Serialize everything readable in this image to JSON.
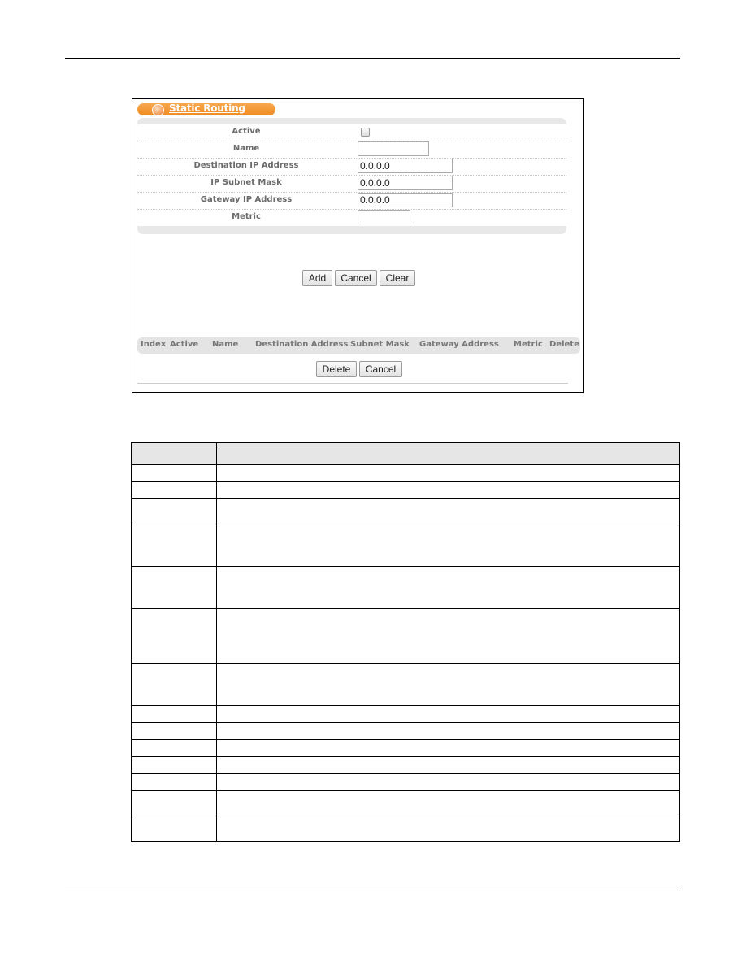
{
  "figure": {
    "title": "Static Routing",
    "form": {
      "rows": [
        {
          "label": "Active",
          "type": "checkbox",
          "checked": false
        },
        {
          "label": "Name",
          "type": "text",
          "value": ""
        },
        {
          "label": "Destination IP Address",
          "type": "text",
          "value": "0.0.0.0"
        },
        {
          "label": "IP Subnet Mask",
          "type": "text",
          "value": "0.0.0.0"
        },
        {
          "label": "Gateway IP Address",
          "type": "text",
          "value": "0.0.0.0"
        },
        {
          "label": "Metric",
          "type": "text",
          "value": ""
        }
      ]
    },
    "buttons": {
      "add": "Add",
      "cancel": "Cancel",
      "clear": "Clear"
    },
    "list": {
      "columns": [
        "Index",
        "Active",
        "Name",
        "Destination Address",
        "Subnet Mask",
        "Gateway Address",
        "Metric",
        "Delete"
      ],
      "buttons": {
        "delete": "Delete",
        "cancel": "Cancel"
      }
    }
  },
  "doc_table": {
    "header": [
      "",
      ""
    ],
    "row_count": 14
  }
}
